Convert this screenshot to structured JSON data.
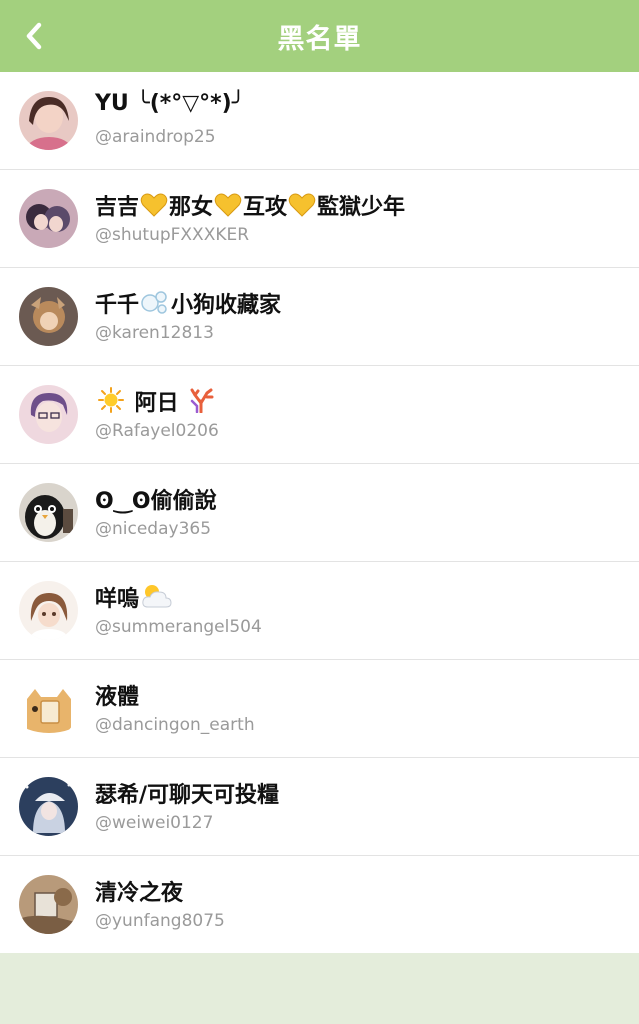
{
  "header": {
    "title": "黑名單",
    "back_icon": "chevron-left-icon"
  },
  "colors": {
    "header_bg": "#a3d07e",
    "page_bg": "#e4eddb",
    "handle_text": "#9a9a9a"
  },
  "blocked_users": [
    {
      "name": "YU ╰(*°▽°*)╯",
      "handle": "@araindrop25"
    },
    {
      "name_parts": [
        "吉吉",
        "yellow-heart",
        "那女",
        "yellow-heart",
        "互攻",
        "yellow-heart",
        "監獄少年"
      ],
      "n1": "吉吉",
      "n2": "那女",
      "n3": "互攻",
      "n4": "監獄少年",
      "handle": "@shutupFXXXKER"
    },
    {
      "n1": "千千",
      "n2": "小狗收藏家",
      "emoji": "bubbles-icon",
      "handle": "@karen12813"
    },
    {
      "n1": "阿日",
      "emoji1": "sun-icon",
      "emoji2": "coral-icon",
      "handle": "@Rafayel0206"
    },
    {
      "name": "ʘ‿ʘ偷偷說",
      "n1": "ʘ‿ʘ",
      "n2": "偷偷說",
      "handle": "@niceday365"
    },
    {
      "n1": "咩嗚",
      "emoji": "sun-behind-cloud-icon",
      "handle": "@summerangel504"
    },
    {
      "name": "液體",
      "handle": "@dancingon_earth"
    },
    {
      "name": "瑟希/可聊天可投糧",
      "handle": "@weiwei0127"
    },
    {
      "name": "清冷之夜",
      "handle": "@yunfang8075"
    }
  ]
}
